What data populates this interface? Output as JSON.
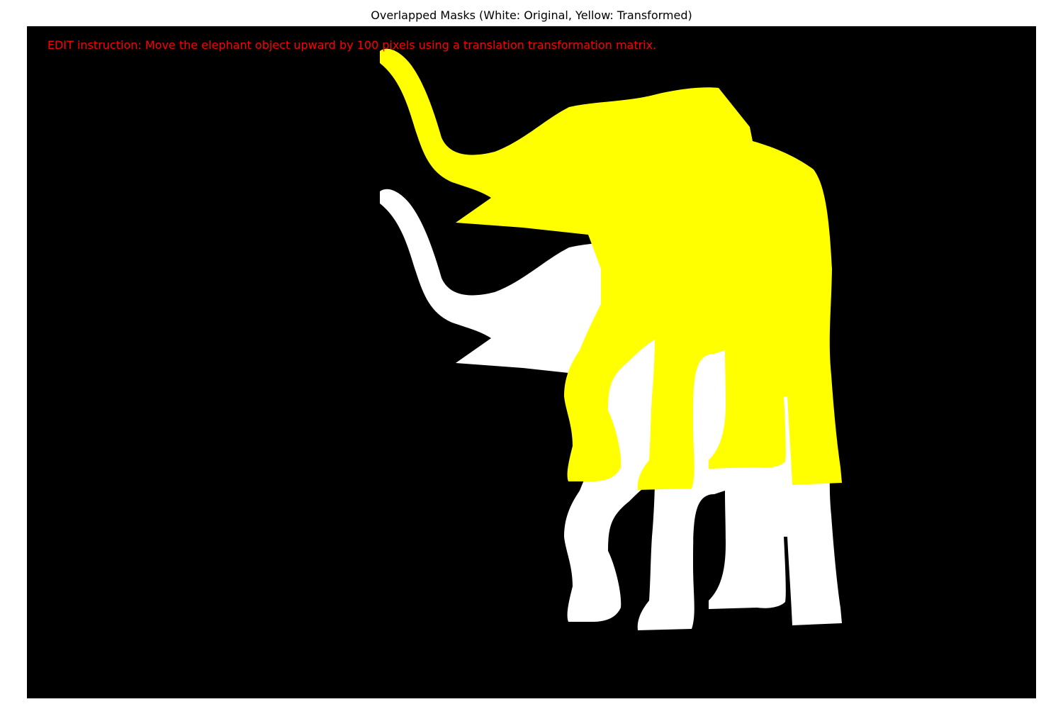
{
  "figure": {
    "title": "Overlapped Masks (White: Original, Yellow: Transformed)"
  },
  "annotation": {
    "text": "EDIT instruction: Move the elephant object upward by 100 pixels using a translation transformation matrix.",
    "color": "#ff0000"
  },
  "masks": {
    "background_color": "#000000",
    "original_color": "#ffffff",
    "transformed_color": "#ffff00",
    "vertical_shift_pixels": 100
  }
}
